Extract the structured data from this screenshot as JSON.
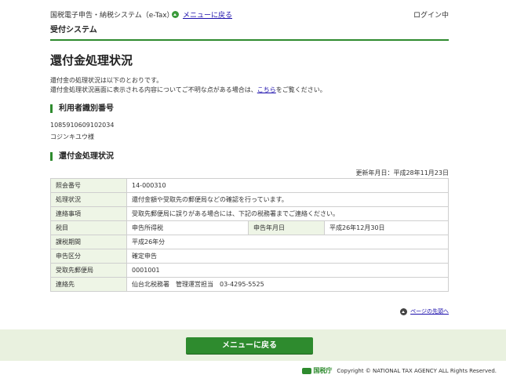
{
  "header": {
    "system_name": "国税電子申告・納税システム（e-Tax）",
    "menu_link": "メニューに戻る",
    "login_status": "ログイン中",
    "sub_system": "受付システム"
  },
  "page": {
    "title": "還付金処理状況",
    "intro_line1": "還付金の処理状況は以下のとおりです。",
    "intro_line2_before": "還付金処理状況画面に表示される内容についてご不明な点がある場合は、",
    "intro_line2_link": "こちら",
    "intro_line2_after": "をご覧ください。"
  },
  "user": {
    "section_title": "利用者識別番号",
    "id": "1085910609102034",
    "name": "コジンキユウ様"
  },
  "status": {
    "section_title": "還付金処理状況",
    "updated": "更新年月日：平成28年11月23日",
    "rows": {
      "ref_label": "照会番号",
      "ref_value": "14-000310",
      "proc_label": "処理状況",
      "proc_value": "還付金額や受取先の郵便局などの確認を行っています。",
      "contact_label": "連絡事項",
      "contact_value": "受取先郵便局に誤りがある場合には、下記の税務署までご連絡ください。",
      "tax_label": "税目",
      "tax_value": "申告所得税",
      "date_label": "申告年月日",
      "date_value": "平成26年12月30日",
      "period_label": "課税期間",
      "period_value": "平成26年分",
      "type_label": "申告区分",
      "type_value": "確定申告",
      "post_label": "受取先郵便局",
      "post_value": "0001001",
      "office_label": "連絡先",
      "office_value": "仙台北税務署　管理運営担当　03-4295-5525"
    }
  },
  "footer": {
    "top_link": "ページの先頭へ",
    "menu_button": "メニューに戻る",
    "agency_logo": "国税庁",
    "copyright": "Copyright © NATIONAL TAX AGENCY ALL Rights Reserved."
  },
  "colors": {
    "accent": "#2e8b2e",
    "label_bg": "#eef5e6",
    "footer_bg": "#e9f1df"
  }
}
